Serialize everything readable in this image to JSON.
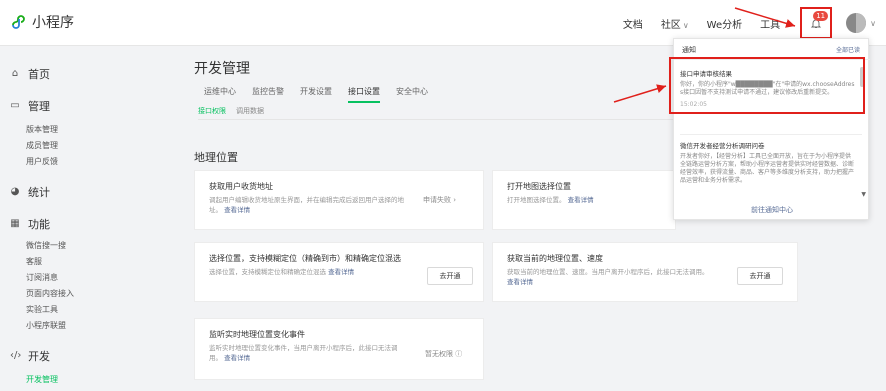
{
  "app": {
    "name": "小程序"
  },
  "topnav": {
    "items": [
      {
        "label": "文档"
      },
      {
        "label": "社区"
      },
      {
        "label": "We分析"
      },
      {
        "label": "工具"
      }
    ],
    "notification_count": "11"
  },
  "sidebar": {
    "groups": [
      {
        "label": "首页",
        "icon": "home-icon"
      },
      {
        "label": "管理",
        "icon": "monitor-icon",
        "items": [
          "版本管理",
          "成员管理",
          "用户反馈"
        ]
      },
      {
        "label": "统计",
        "icon": "pie-chart-icon"
      },
      {
        "label": "功能",
        "icon": "grid-icon",
        "items": [
          "微信搜一搜",
          "客服",
          "订阅消息",
          "页面内容接入",
          "实验工具",
          "小程序联盟"
        ]
      },
      {
        "label": "开发",
        "icon": "code-icon",
        "items": [
          "开发管理"
        ]
      }
    ]
  },
  "main": {
    "title": "开发管理",
    "tabs": [
      "运维中心",
      "监控告警",
      "开发设置",
      "接口设置",
      "安全中心"
    ],
    "active_tab": "接口设置",
    "subtabs": [
      "接口权限",
      "调用数据"
    ],
    "section_title": "地理位置",
    "cards": [
      {
        "title": "获取用户收货地址",
        "desc": "调起用户编辑收货地址原生界面，并在编辑完成后返回用户选择的地址。",
        "link": "查看详情",
        "action": "申请失败 ›"
      },
      {
        "title": "打开地图选择位置",
        "desc": "打开地图选择位置。",
        "link": "查看详情",
        "action": ""
      },
      {
        "title": "选择位置，支持模糊定位（精确到市）和精确定位混选",
        "desc": "选择位置，支持模糊定位和精确定位混选",
        "link": "查看详情",
        "action": "去开通"
      },
      {
        "title": "获取当前的地理位置、速度",
        "desc": "获取当前的地理位置、速度。当用户离开小程序后，此接口无法调用。",
        "link": "查看详情",
        "action": "去开通"
      },
      {
        "title": "监听实时地理位置变化事件",
        "desc": "监听实时地理位置变化事件，当用户离开小程序后，此接口无法调用。",
        "link": "查看详情",
        "action": "暂无权限 ⓘ"
      }
    ]
  },
  "notifications": {
    "header": "通知",
    "mark_all": "全部已读",
    "items": [
      {
        "title": "接口申请审核结果",
        "body": "你好，你的小程序\"w████████\"在\"申请的wx.chooseAddress接口因暂不支持测试申请不通过，建议修改后重新提交。",
        "time": "15:02:05"
      },
      {
        "title": "微信开发者经营分析调研问卷",
        "body": "开发者你好，【经营分析】工具已全面开放，旨在于为小程序提供全链路运营分析方案，帮助小程序运营者提供实时经营数据、诊断经营效率，获得流量、商品、客户等多维度分析支持，助力把握产品运营和业务分析需求。"
      }
    ],
    "footer": "前往通知中心"
  },
  "colors": {
    "accent": "#07c160",
    "alert": "#e0201b",
    "link": "#576b95"
  }
}
